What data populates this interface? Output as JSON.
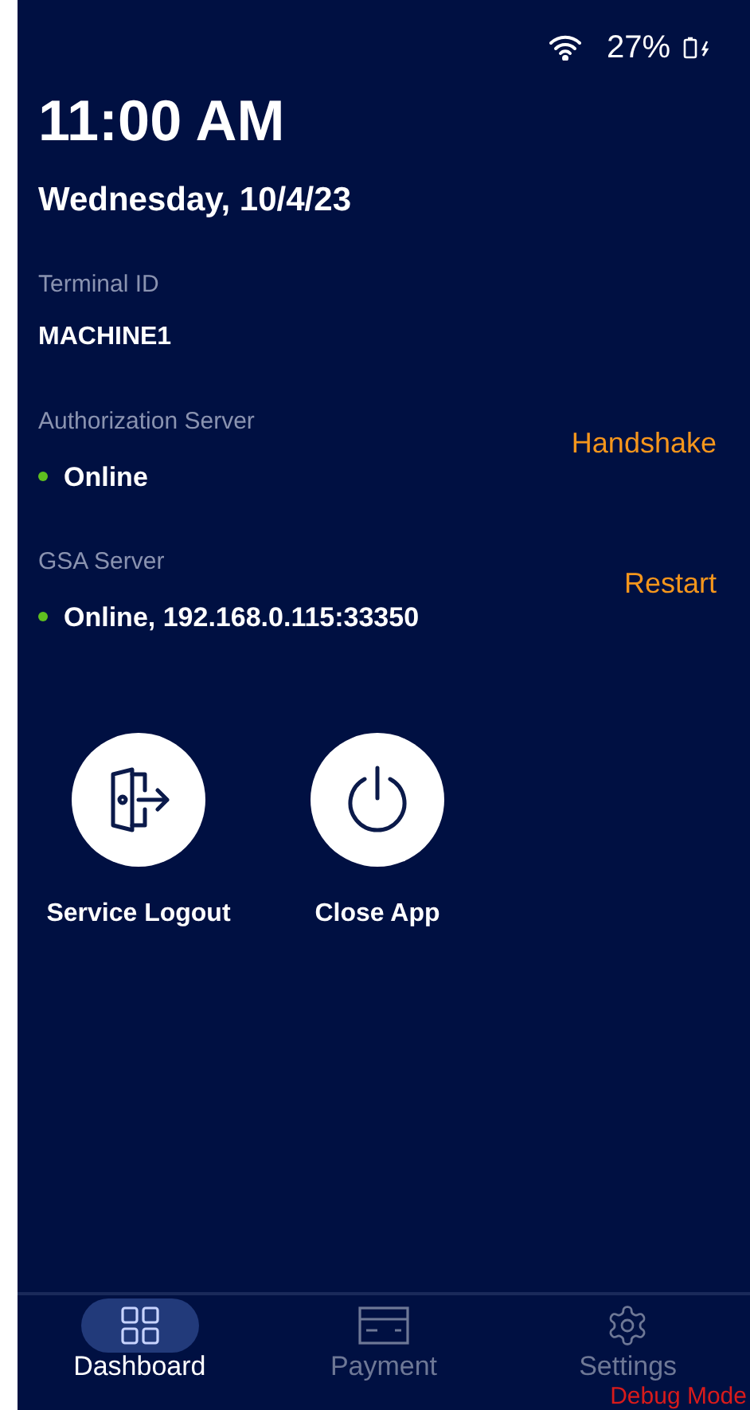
{
  "status_bar": {
    "battery": "27%"
  },
  "clock": {
    "time": "11:00 AM",
    "date": "Wednesday, 10/4/23"
  },
  "terminal": {
    "label": "Terminal ID",
    "value": "MACHINE1"
  },
  "servers": [
    {
      "label": "Authorization Server",
      "status": "Online",
      "color": "#5fbf1f",
      "action": "Handshake"
    },
    {
      "label": "GSA Server",
      "status": "Online, 192.168.0.115:33350",
      "color": "#5fbf1f",
      "action": "Restart"
    }
  ],
  "actions": [
    {
      "kind": "logout",
      "label": "Service Logout"
    },
    {
      "kind": "power",
      "label": "Close App"
    }
  ],
  "nav": [
    {
      "kind": "dashboard",
      "label": "Dashboard",
      "selected": true
    },
    {
      "kind": "payment",
      "label": "Payment",
      "selected": false
    },
    {
      "kind": "settings",
      "label": "Settings",
      "selected": false
    }
  ],
  "debug_label": "Debug Mode"
}
